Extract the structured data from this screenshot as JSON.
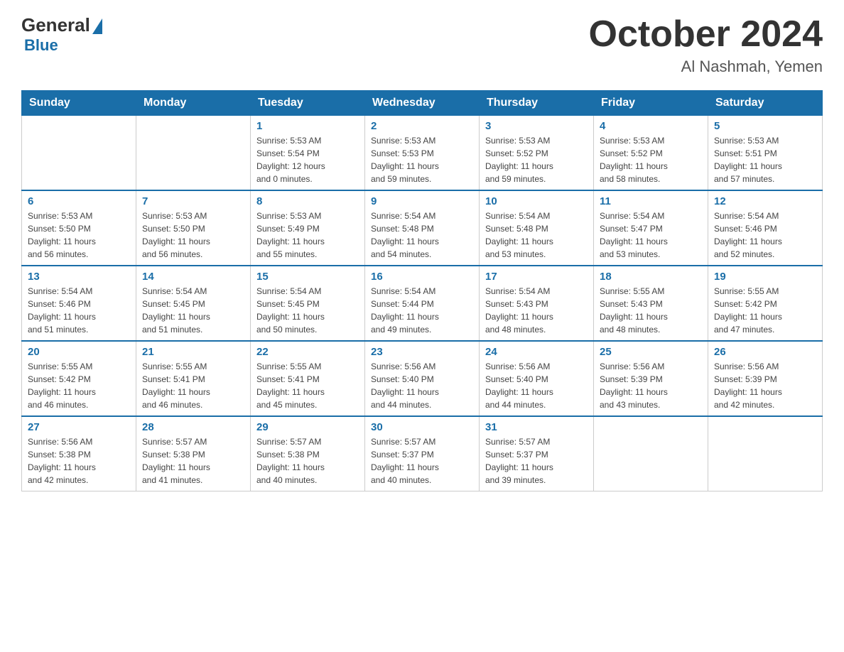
{
  "logo": {
    "general": "General",
    "blue": "Blue"
  },
  "title": "October 2024",
  "location": "Al Nashmah, Yemen",
  "days_of_week": [
    "Sunday",
    "Monday",
    "Tuesday",
    "Wednesday",
    "Thursday",
    "Friday",
    "Saturday"
  ],
  "weeks": [
    [
      {
        "day": "",
        "info": ""
      },
      {
        "day": "",
        "info": ""
      },
      {
        "day": "1",
        "info": "Sunrise: 5:53 AM\nSunset: 5:54 PM\nDaylight: 12 hours\nand 0 minutes."
      },
      {
        "day": "2",
        "info": "Sunrise: 5:53 AM\nSunset: 5:53 PM\nDaylight: 11 hours\nand 59 minutes."
      },
      {
        "day": "3",
        "info": "Sunrise: 5:53 AM\nSunset: 5:52 PM\nDaylight: 11 hours\nand 59 minutes."
      },
      {
        "day": "4",
        "info": "Sunrise: 5:53 AM\nSunset: 5:52 PM\nDaylight: 11 hours\nand 58 minutes."
      },
      {
        "day": "5",
        "info": "Sunrise: 5:53 AM\nSunset: 5:51 PM\nDaylight: 11 hours\nand 57 minutes."
      }
    ],
    [
      {
        "day": "6",
        "info": "Sunrise: 5:53 AM\nSunset: 5:50 PM\nDaylight: 11 hours\nand 56 minutes."
      },
      {
        "day": "7",
        "info": "Sunrise: 5:53 AM\nSunset: 5:50 PM\nDaylight: 11 hours\nand 56 minutes."
      },
      {
        "day": "8",
        "info": "Sunrise: 5:53 AM\nSunset: 5:49 PM\nDaylight: 11 hours\nand 55 minutes."
      },
      {
        "day": "9",
        "info": "Sunrise: 5:54 AM\nSunset: 5:48 PM\nDaylight: 11 hours\nand 54 minutes."
      },
      {
        "day": "10",
        "info": "Sunrise: 5:54 AM\nSunset: 5:48 PM\nDaylight: 11 hours\nand 53 minutes."
      },
      {
        "day": "11",
        "info": "Sunrise: 5:54 AM\nSunset: 5:47 PM\nDaylight: 11 hours\nand 53 minutes."
      },
      {
        "day": "12",
        "info": "Sunrise: 5:54 AM\nSunset: 5:46 PM\nDaylight: 11 hours\nand 52 minutes."
      }
    ],
    [
      {
        "day": "13",
        "info": "Sunrise: 5:54 AM\nSunset: 5:46 PM\nDaylight: 11 hours\nand 51 minutes."
      },
      {
        "day": "14",
        "info": "Sunrise: 5:54 AM\nSunset: 5:45 PM\nDaylight: 11 hours\nand 51 minutes."
      },
      {
        "day": "15",
        "info": "Sunrise: 5:54 AM\nSunset: 5:45 PM\nDaylight: 11 hours\nand 50 minutes."
      },
      {
        "day": "16",
        "info": "Sunrise: 5:54 AM\nSunset: 5:44 PM\nDaylight: 11 hours\nand 49 minutes."
      },
      {
        "day": "17",
        "info": "Sunrise: 5:54 AM\nSunset: 5:43 PM\nDaylight: 11 hours\nand 48 minutes."
      },
      {
        "day": "18",
        "info": "Sunrise: 5:55 AM\nSunset: 5:43 PM\nDaylight: 11 hours\nand 48 minutes."
      },
      {
        "day": "19",
        "info": "Sunrise: 5:55 AM\nSunset: 5:42 PM\nDaylight: 11 hours\nand 47 minutes."
      }
    ],
    [
      {
        "day": "20",
        "info": "Sunrise: 5:55 AM\nSunset: 5:42 PM\nDaylight: 11 hours\nand 46 minutes."
      },
      {
        "day": "21",
        "info": "Sunrise: 5:55 AM\nSunset: 5:41 PM\nDaylight: 11 hours\nand 46 minutes."
      },
      {
        "day": "22",
        "info": "Sunrise: 5:55 AM\nSunset: 5:41 PM\nDaylight: 11 hours\nand 45 minutes."
      },
      {
        "day": "23",
        "info": "Sunrise: 5:56 AM\nSunset: 5:40 PM\nDaylight: 11 hours\nand 44 minutes."
      },
      {
        "day": "24",
        "info": "Sunrise: 5:56 AM\nSunset: 5:40 PM\nDaylight: 11 hours\nand 44 minutes."
      },
      {
        "day": "25",
        "info": "Sunrise: 5:56 AM\nSunset: 5:39 PM\nDaylight: 11 hours\nand 43 minutes."
      },
      {
        "day": "26",
        "info": "Sunrise: 5:56 AM\nSunset: 5:39 PM\nDaylight: 11 hours\nand 42 minutes."
      }
    ],
    [
      {
        "day": "27",
        "info": "Sunrise: 5:56 AM\nSunset: 5:38 PM\nDaylight: 11 hours\nand 42 minutes."
      },
      {
        "day": "28",
        "info": "Sunrise: 5:57 AM\nSunset: 5:38 PM\nDaylight: 11 hours\nand 41 minutes."
      },
      {
        "day": "29",
        "info": "Sunrise: 5:57 AM\nSunset: 5:38 PM\nDaylight: 11 hours\nand 40 minutes."
      },
      {
        "day": "30",
        "info": "Sunrise: 5:57 AM\nSunset: 5:37 PM\nDaylight: 11 hours\nand 40 minutes."
      },
      {
        "day": "31",
        "info": "Sunrise: 5:57 AM\nSunset: 5:37 PM\nDaylight: 11 hours\nand 39 minutes."
      },
      {
        "day": "",
        "info": ""
      },
      {
        "day": "",
        "info": ""
      }
    ]
  ]
}
